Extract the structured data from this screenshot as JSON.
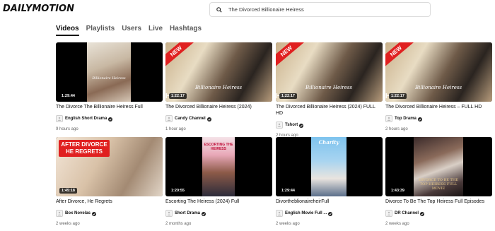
{
  "header": {
    "logo": "DAILYMOTION",
    "search_value": "The Divorced Billionaire Heiress"
  },
  "tabs": [
    {
      "label": "Videos",
      "active": true
    },
    {
      "label": "Playlists"
    },
    {
      "label": "Users"
    },
    {
      "label": "Live"
    },
    {
      "label": "Hashtags"
    }
  ],
  "videos": [
    {
      "title": "The Divorce The Billionaire Heiress Full",
      "channel": "English Short Drama",
      "age": "9 hours ago",
      "duration": "1:29:44",
      "badge": "",
      "poster_text": "Billionaire Heiress"
    },
    {
      "title": "The Divorced Billionaire Heiress (2024)",
      "channel": "Candy Channel",
      "age": "1 hour ago",
      "duration": "1:22:17",
      "badge": "NEW",
      "poster_text": "Billionaire Heiress"
    },
    {
      "title": "The Divorced Billionaire Heiress (2024) FULL HD",
      "channel": "Tshort",
      "age": "2 hours ago",
      "duration": "1:22:17",
      "badge": "NEW",
      "poster_text": "Billionaire Heiress"
    },
    {
      "title": "The Divorced Billionaire Heiress – FULL HD",
      "channel": "Top Drama",
      "age": "2 hours ago",
      "duration": "1:22:17",
      "badge": "NEW",
      "poster_text": "Billionaire Heiress"
    },
    {
      "title": "After Divorce, He Regrets",
      "channel": "Box Novelas",
      "age": "2 weeks ago",
      "duration": "1:45:18",
      "badge": "",
      "poster_text": "AFTER DIVORCE HE REGRETS"
    },
    {
      "title": "Escorting The Heiress (2024) Full",
      "channel": "Short Drama",
      "age": "2 months ago",
      "duration": "1:20:55",
      "badge": "",
      "poster_text": "ESCORTING THE HEIRESS"
    },
    {
      "title": "DivortheblionaireheirFull",
      "channel": "English Movie Full ...",
      "age": "2 weeks ago",
      "duration": "1:29:44",
      "badge": "",
      "poster_text": "Charity"
    },
    {
      "title": "Divorce To Be The Top Heiress Full Episodes",
      "channel": "DR Channel",
      "age": "2 weeks ago",
      "duration": "1:43:39",
      "badge": "",
      "poster_text": "DIVORCE TO BE THE TOP HEIRESS FULL MOVIE"
    }
  ],
  "colors": {
    "accent_red": "#e02020",
    "text_primary": "#0d0d0d",
    "text_muted": "#666666",
    "verified_blue": "#222222"
  }
}
